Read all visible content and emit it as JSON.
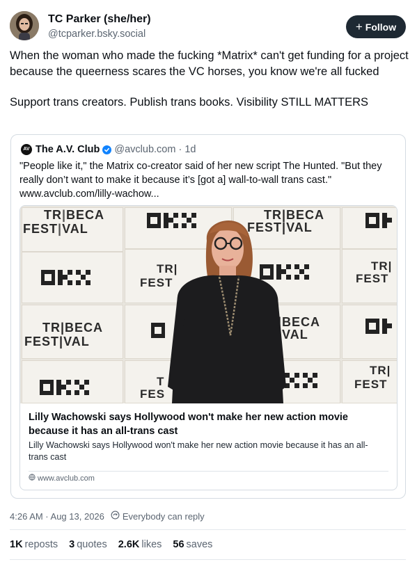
{
  "author": {
    "display_name": "TC Parker (she/her)",
    "handle": "@tcparker.bsky.social",
    "follow_label": "Follow"
  },
  "post": {
    "paragraphs": [
      "When the woman who made the fucking *Matrix* can't get funding for a project because the queerness scares the VC horses, you know we're all fucked",
      "Support trans creators. Publish trans books. Visibility STILL MATTERS"
    ]
  },
  "quote": {
    "avatar_text": "AV",
    "author_name": "The A.V. Club",
    "handle_time": "@avclub.com · 1d",
    "text": "\"People like it,\" the Matrix co-creator said of her new script The Hunted. \"But they really don’t want to make it because it’s [got a] wall-to-wall trans cast.\" www.avclub.com/lilly-wachow...",
    "embed": {
      "title": "Lilly Wachowski says Hollywood won't make her new action movie because it has an all-trans cast",
      "description": "Lilly Wachowski says Hollywood won't make her new action movie because it has an all-trans cast",
      "domain": "www.avclub.com",
      "backdrop_logos": [
        "TR",
        "BECA",
        "FEST",
        "VAL",
        "OKX"
      ]
    }
  },
  "meta": {
    "timestamp": "4:26 AM · Aug 13, 2026",
    "reply_setting": "Everybody can reply"
  },
  "stats": {
    "reposts_count": "1K",
    "reposts_label": "reposts",
    "quotes_count": "3",
    "quotes_label": "quotes",
    "likes_count": "2.6K",
    "likes_label": "likes",
    "saves_count": "56",
    "saves_label": "saves"
  },
  "colors": {
    "follow_button": "#1e2933",
    "verified_badge": "#1083fe",
    "muted_text": "#5b6571",
    "border": "#d4dbe2"
  },
  "icons": [
    "avatar",
    "plus-icon",
    "verified-check-icon",
    "globe-icon",
    "reply-settings-icon"
  ]
}
